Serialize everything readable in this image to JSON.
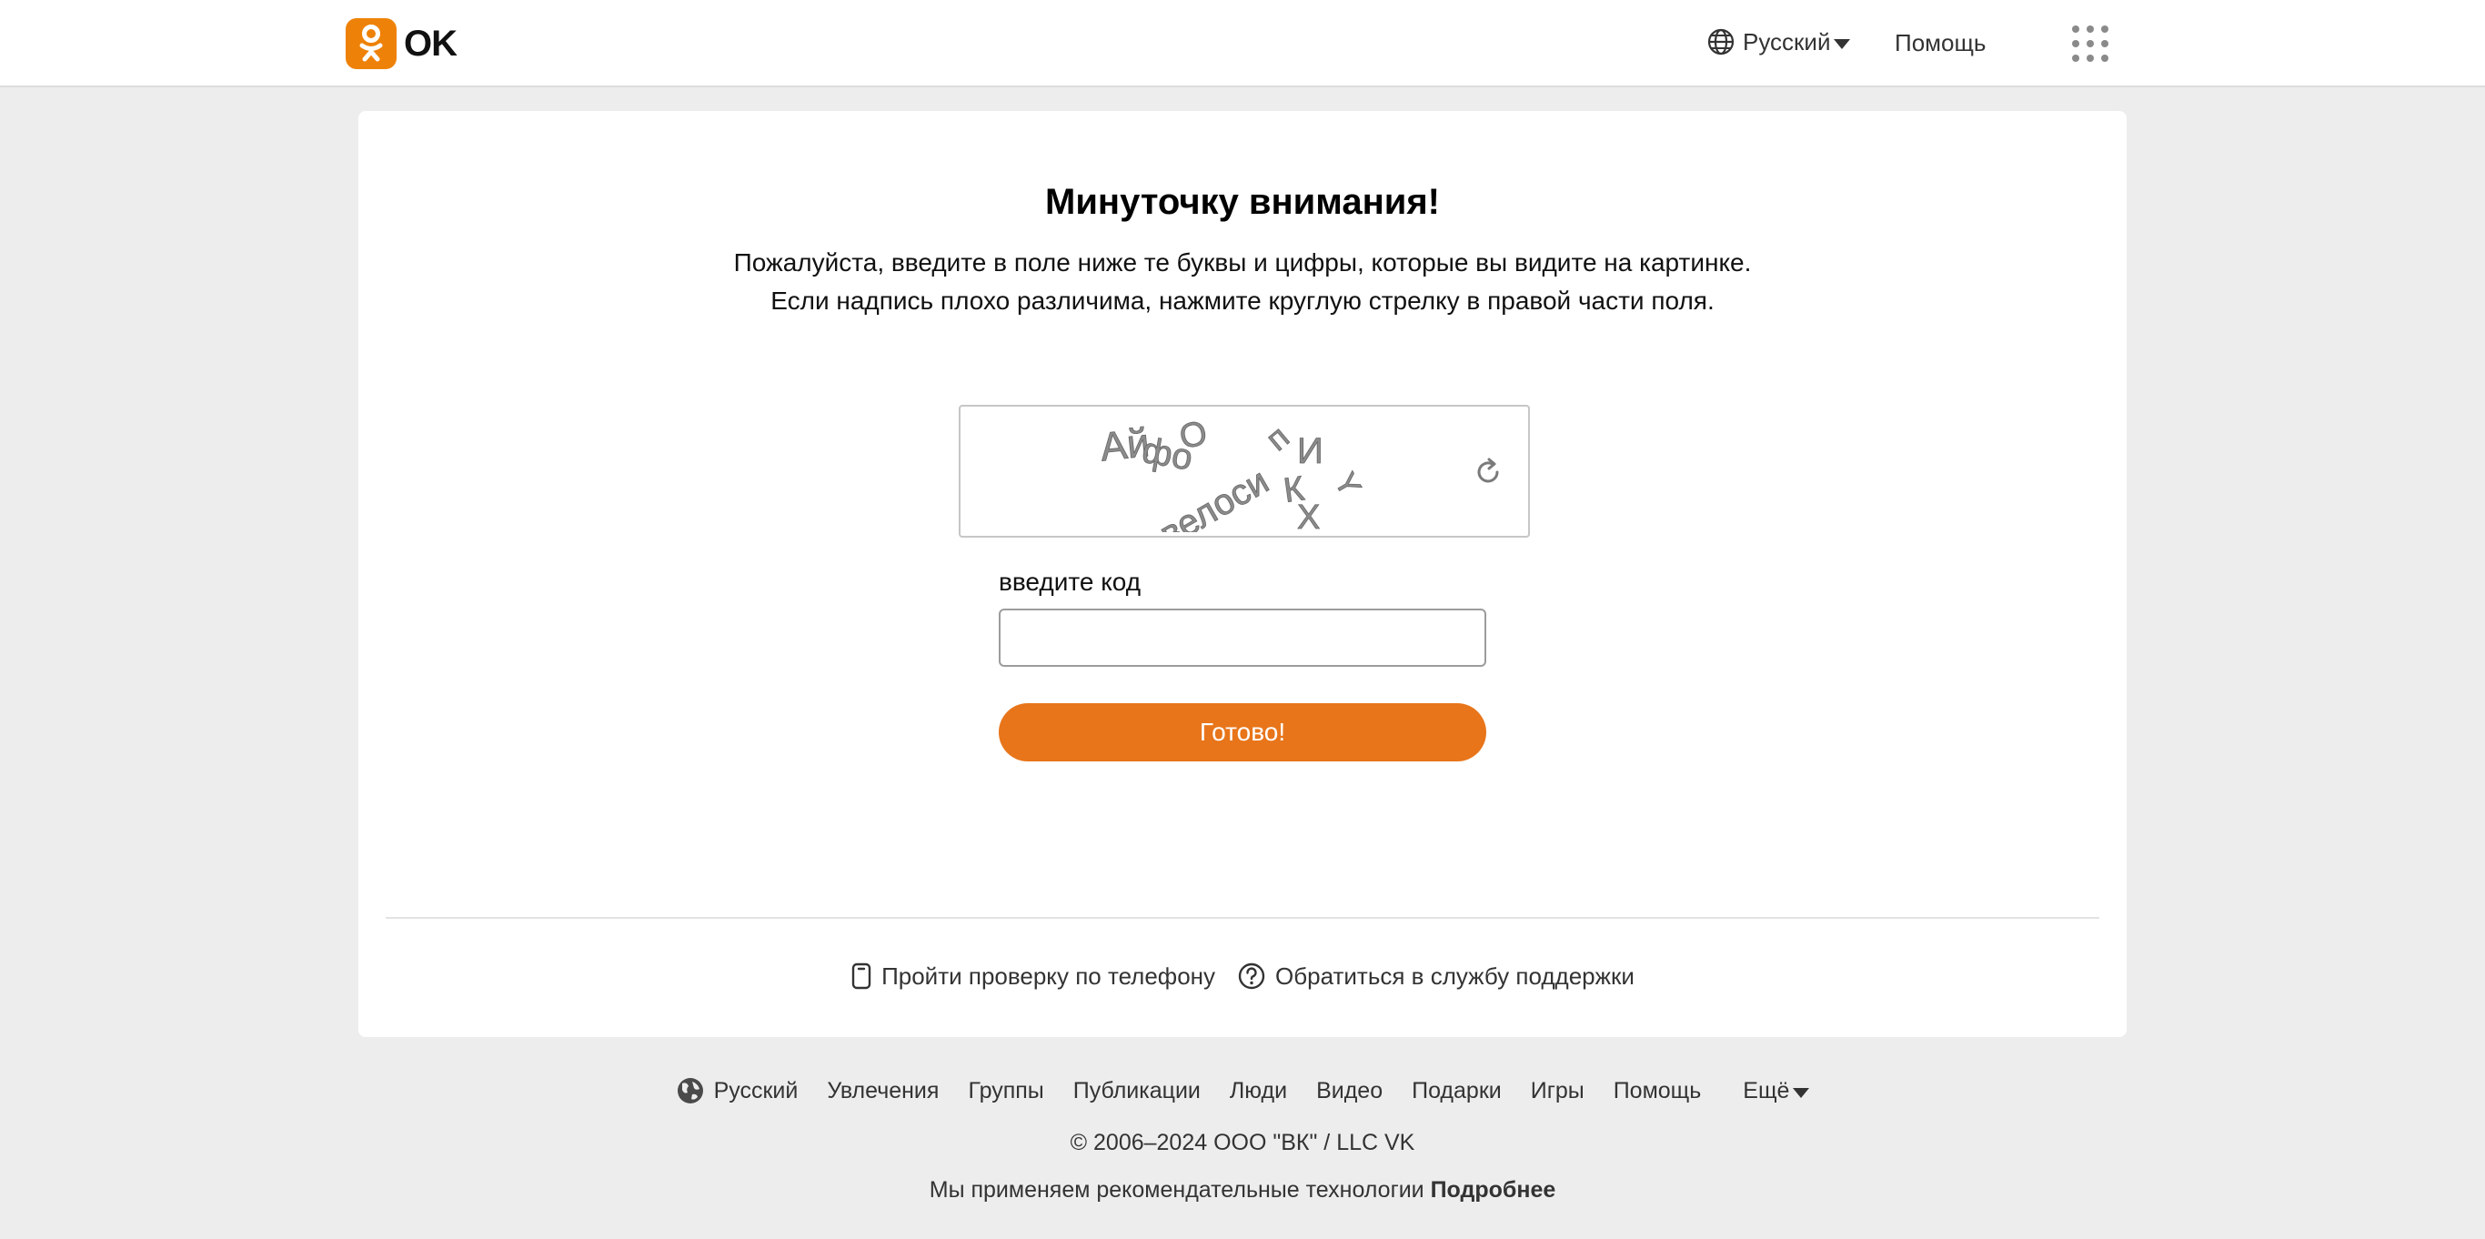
{
  "header": {
    "logo_text": "OK",
    "language": "Русский",
    "help": "Помощь"
  },
  "colors": {
    "accent": "#e8751a",
    "logo": "#ee8208",
    "background": "#ededed"
  },
  "captcha_page": {
    "title": "Минуточку внимания!",
    "description": "Пожалуйста, введите в поле ниже те буквы и цифры, которые вы видите на картинке. Если надпись плохо различима, нажмите круглую стрелку в правой части поля.",
    "input_label": "введите код",
    "input_value": "",
    "submit_label": "Готово!",
    "refresh_icon": "refresh-icon",
    "captcha_letters": [
      "Ай",
      "фо",
      "О",
      "велоси",
      "п",
      "И",
      "К",
      "Х",
      "Y"
    ]
  },
  "alt_actions": {
    "phone_check": "Пройти проверку по телефону",
    "support": "Обратиться в службу поддержки"
  },
  "footer": {
    "nav": [
      {
        "label": "Русский"
      },
      {
        "label": "Увлечения"
      },
      {
        "label": "Группы"
      },
      {
        "label": "Публикации"
      },
      {
        "label": "Люди"
      },
      {
        "label": "Видео"
      },
      {
        "label": "Подарки"
      },
      {
        "label": "Игры"
      },
      {
        "label": "Помощь"
      }
    ],
    "more": "Ещё",
    "copyright": "© 2006–2024 ООО \"ВК\" / LLC VK",
    "cookie_text": "Мы применяем рекомендательные технологии",
    "cookie_link": "Подробнее"
  }
}
